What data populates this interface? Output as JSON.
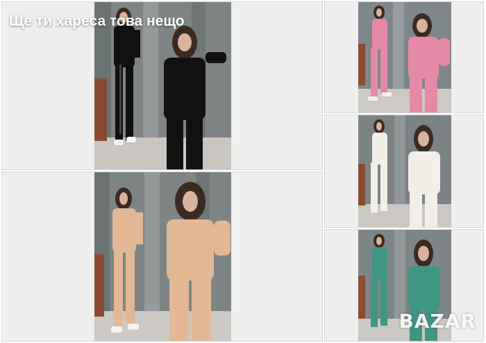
{
  "gallery": {
    "caption": "Ще ти хареса това нещо",
    "watermark": "BAZAR",
    "photos": [
      {
        "outfit": "black tracksuit",
        "color": "#111111"
      },
      {
        "outfit": "pink tracksuit",
        "color": "#e58aa6"
      },
      {
        "outfit": "white tracksuit",
        "color": "#f1efe8"
      },
      {
        "outfit": "beige tracksuit",
        "color": "#e3b896"
      },
      {
        "outfit": "green tracksuit",
        "color": "#3f9683"
      }
    ]
  },
  "colors": {
    "tile_bg": "#efefef",
    "tile_border": "#d6d6d6",
    "studio_wall": "#7f8585",
    "floor": "#d4d0cb",
    "hair": "#3b2a22",
    "skin": "#d9b39e"
  }
}
